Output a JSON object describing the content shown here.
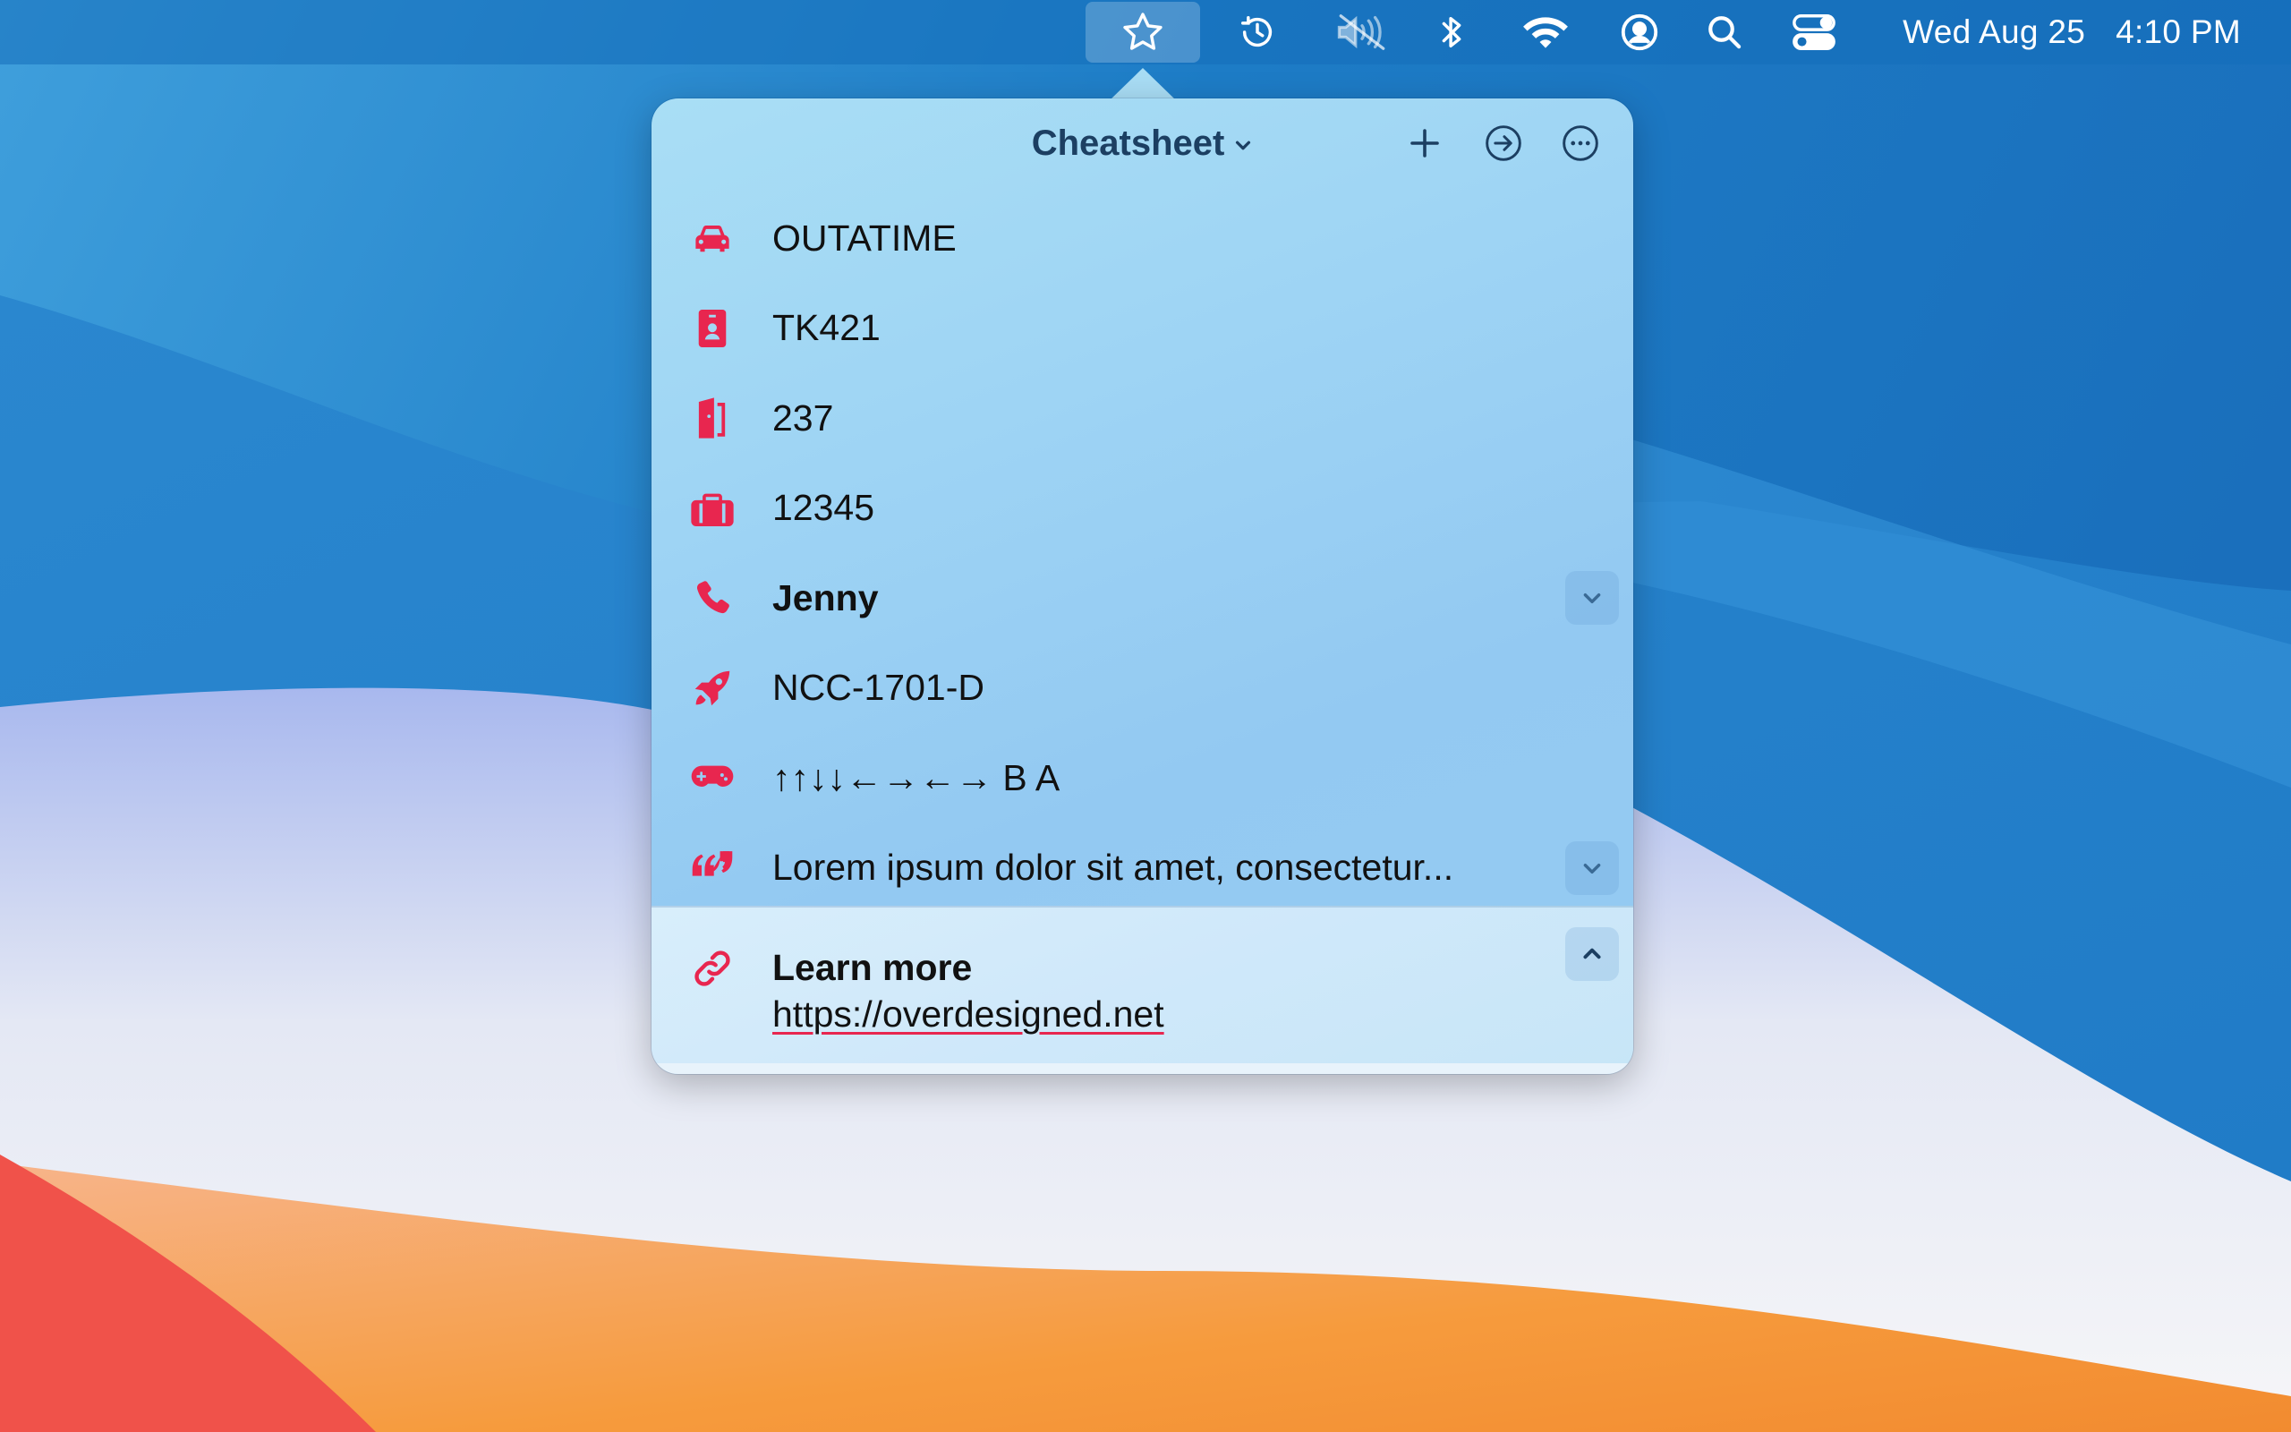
{
  "menubar": {
    "icons": [
      {
        "name": "star-icon",
        "active": true
      },
      {
        "name": "time-machine-icon"
      },
      {
        "name": "volume-muted-icon"
      },
      {
        "name": "bluetooth-icon"
      },
      {
        "name": "wifi-icon"
      },
      {
        "name": "user-icon"
      },
      {
        "name": "spotlight-search-icon"
      },
      {
        "name": "control-center-icon"
      }
    ],
    "date": "Wed Aug 25",
    "time": "4:10 PM"
  },
  "popover": {
    "title": "Cheatsheet",
    "header_buttons": [
      "add-icon",
      "open-icon",
      "more-icon"
    ],
    "items": [
      {
        "icon": "car-icon",
        "text": "OUTATIME",
        "bold": false,
        "expandable": false
      },
      {
        "icon": "id-badge-icon",
        "text": "TK421",
        "bold": false,
        "expandable": false
      },
      {
        "icon": "door-icon",
        "text": "237",
        "bold": false,
        "expandable": false
      },
      {
        "icon": "briefcase-icon",
        "text": "12345",
        "bold": false,
        "expandable": false
      },
      {
        "icon": "phone-icon",
        "text": "Jenny",
        "bold": true,
        "expandable": true
      },
      {
        "icon": "rocket-icon",
        "text": "NCC-1701-D",
        "bold": false,
        "expandable": false
      },
      {
        "icon": "gamepad-icon",
        "text": "↑↑↓↓←→←→ B A",
        "bold": false,
        "expandable": false
      },
      {
        "icon": "quote-icon",
        "text": "Lorem ipsum dolor sit amet, consectetur...",
        "bold": false,
        "expandable": true
      }
    ],
    "expanded_item": {
      "icon": "link-icon",
      "title": "Learn more",
      "url": "https://overdesigned.net"
    }
  },
  "colors": {
    "accent": "#e8264f",
    "title_text": "#1c3f62",
    "menubar_text": "#ffffff"
  }
}
